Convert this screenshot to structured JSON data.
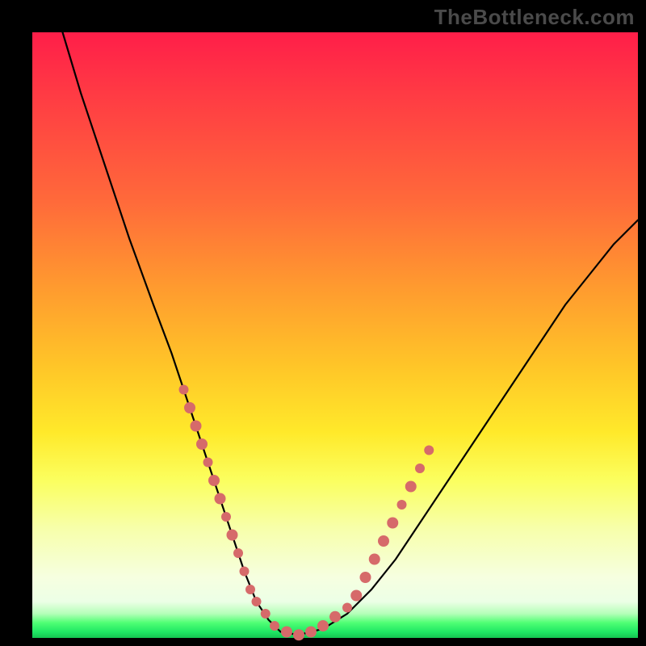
{
  "watermark": "TheBottleneck.com",
  "chart_data": {
    "type": "line",
    "title": "",
    "xlabel": "",
    "ylabel": "",
    "xlim": [
      0,
      100
    ],
    "ylim": [
      0,
      100
    ],
    "grid": false,
    "legend": false,
    "series": [
      {
        "name": "curve",
        "color": "#000000",
        "x": [
          5,
          8,
          12,
          16,
          20,
          23,
          25,
          27,
          29,
          31,
          33,
          35,
          37,
          39,
          41,
          44,
          48,
          52,
          56,
          60,
          64,
          68,
          72,
          76,
          80,
          84,
          88,
          92,
          96,
          100
        ],
        "y": [
          100,
          90,
          78,
          66,
          55,
          47,
          41,
          35,
          29,
          23,
          17,
          11,
          6,
          3,
          1,
          0.5,
          1.5,
          4,
          8,
          13,
          19,
          25,
          31,
          37,
          43,
          49,
          55,
          60,
          65,
          69
        ]
      }
    ],
    "markers": {
      "name": "highlighted-points",
      "color": "#d66a6a",
      "points": [
        {
          "x": 25,
          "y": 41,
          "r": 6
        },
        {
          "x": 26,
          "y": 38,
          "r": 7
        },
        {
          "x": 27,
          "y": 35,
          "r": 7
        },
        {
          "x": 28,
          "y": 32,
          "r": 7
        },
        {
          "x": 29,
          "y": 29,
          "r": 6
        },
        {
          "x": 30,
          "y": 26,
          "r": 7
        },
        {
          "x": 31,
          "y": 23,
          "r": 7
        },
        {
          "x": 32,
          "y": 20,
          "r": 6
        },
        {
          "x": 33,
          "y": 17,
          "r": 7
        },
        {
          "x": 34,
          "y": 14,
          "r": 6
        },
        {
          "x": 35,
          "y": 11,
          "r": 6
        },
        {
          "x": 36,
          "y": 8,
          "r": 6
        },
        {
          "x": 37,
          "y": 6,
          "r": 6
        },
        {
          "x": 38.5,
          "y": 4,
          "r": 6
        },
        {
          "x": 40,
          "y": 2,
          "r": 6
        },
        {
          "x": 42,
          "y": 1,
          "r": 7
        },
        {
          "x": 44,
          "y": 0.5,
          "r": 7
        },
        {
          "x": 46,
          "y": 1,
          "r": 7
        },
        {
          "x": 48,
          "y": 2,
          "r": 7
        },
        {
          "x": 50,
          "y": 3.5,
          "r": 7
        },
        {
          "x": 52,
          "y": 5,
          "r": 6
        },
        {
          "x": 53.5,
          "y": 7,
          "r": 7
        },
        {
          "x": 55,
          "y": 10,
          "r": 7
        },
        {
          "x": 56.5,
          "y": 13,
          "r": 7
        },
        {
          "x": 58,
          "y": 16,
          "r": 7
        },
        {
          "x": 59.5,
          "y": 19,
          "r": 7
        },
        {
          "x": 61,
          "y": 22,
          "r": 6
        },
        {
          "x": 62.5,
          "y": 25,
          "r": 7
        },
        {
          "x": 64,
          "y": 28,
          "r": 6
        },
        {
          "x": 65.5,
          "y": 31,
          "r": 6
        }
      ]
    }
  }
}
